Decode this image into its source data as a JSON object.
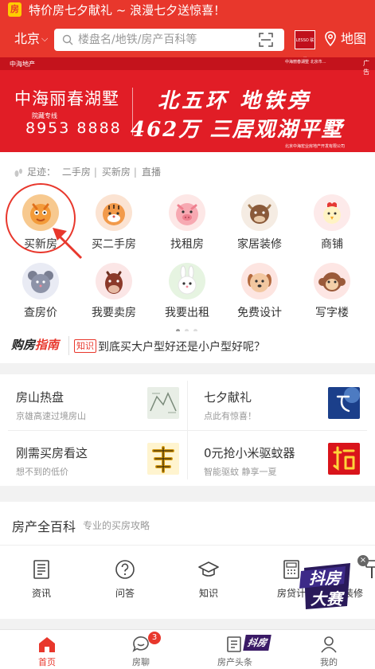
{
  "promo_bar": {
    "logo_char": "房",
    "text": "特价房七夕献礼 ~ 浪漫七夕送惊喜！"
  },
  "header": {
    "city": "北京",
    "search_placeholder": "楼盘名/地铁/房产百科等",
    "brand_badge": "LESSO 联塑",
    "map_label": "地图",
    "icons": [
      "chevron-down-icon",
      "search-icon",
      "scan-icon",
      "map-pin-icon"
    ]
  },
  "banner": {
    "developer": "中海地产",
    "ad_label": "广告",
    "small_print": "中海丽春湖墅 北京市…",
    "project": "中海丽春湖墅",
    "hotline_label": "院藏专线",
    "hotline": "8953 8888",
    "headline_1": "北五环 地铁旁",
    "headline_2": "462万 三居观湖平墅",
    "company": "北京中海宏业房地产开发有限公司",
    "pager": {
      "count": 3,
      "active": 1
    }
  },
  "footprint": {
    "label": "足迹：",
    "links": [
      "二手房",
      "买新房",
      "直播"
    ]
  },
  "services": [
    {
      "label": "买新房",
      "icon": "dragon-icon",
      "color": "#f7c98f"
    },
    {
      "label": "买二手房",
      "icon": "tiger-icon",
      "color": "#fbe3d2"
    },
    {
      "label": "找租房",
      "icon": "pig-icon",
      "color": "#fde7e6"
    },
    {
      "label": "家居装修",
      "icon": "ox-icon",
      "color": "#f5ece3"
    },
    {
      "label": "商铺",
      "icon": "rooster-icon",
      "color": "#fdeaea"
    },
    {
      "label": "查房价",
      "icon": "rat-icon",
      "color": "#e9ebf4"
    },
    {
      "label": "我要卖房",
      "icon": "horse-icon",
      "color": "#fbe6e6"
    },
    {
      "label": "我要出租",
      "icon": "rabbit-icon",
      "color": "#e6f4e1"
    },
    {
      "label": "免费设计",
      "icon": "dog-icon",
      "color": "#fde5e1"
    },
    {
      "label": "写字楼",
      "icon": "monkey-icon",
      "color": "#fde6e4"
    }
  ],
  "services_pager": {
    "count": 3,
    "active": 0
  },
  "guide": {
    "logo_black": "购房",
    "logo_red": "指南",
    "tag": "知识",
    "headline": "到底买大户型好还是小户型好呢？"
  },
  "cards": [
    {
      "title": "房山热盘",
      "subtitle": "京雄高速过境房山",
      "thumb": "map-thumb-icon",
      "color": "#e8eee6"
    },
    {
      "title": "七夕献礼",
      "subtitle": "点此有惊喜！",
      "thumb": "qixi-thumb-icon",
      "color": "#1b3f8a"
    },
    {
      "title": "刚需买房看这",
      "subtitle": "想不到的低价",
      "thumb": "gold-character-icon",
      "color": "#fff4cf"
    },
    {
      "title": "0元抢小米驱蚊器",
      "subtitle": "智能驱蚊 静享一夏",
      "thumb": "grab-character-icon",
      "color": "#d9141b"
    }
  ],
  "encyclopedia": {
    "title": "房产全百科",
    "subtitle": "专业的买房攻略",
    "items": [
      {
        "label": "资讯",
        "icon": "news-icon"
      },
      {
        "label": "问答",
        "icon": "question-icon"
      },
      {
        "label": "知识",
        "icon": "graduation-cap-icon"
      },
      {
        "label": "房贷计",
        "icon": "calculator-icon"
      },
      {
        "label": "装修",
        "icon": "decor-icon"
      }
    ]
  },
  "floating_promo": {
    "line1": "抖房",
    "line2": "大赛",
    "close": "×"
  },
  "tabbar": {
    "tabs": [
      {
        "label": "首页",
        "icon": "home-icon",
        "active": true
      },
      {
        "label": "房聊",
        "icon": "chat-icon",
        "badge": "3"
      },
      {
        "label": "房产头条",
        "icon": "headline-icon",
        "promo": "抖房"
      },
      {
        "label": "我的",
        "icon": "user-icon"
      }
    ]
  },
  "colors": {
    "brand_red": "#e8372c",
    "banner_red": "#e11d26"
  }
}
